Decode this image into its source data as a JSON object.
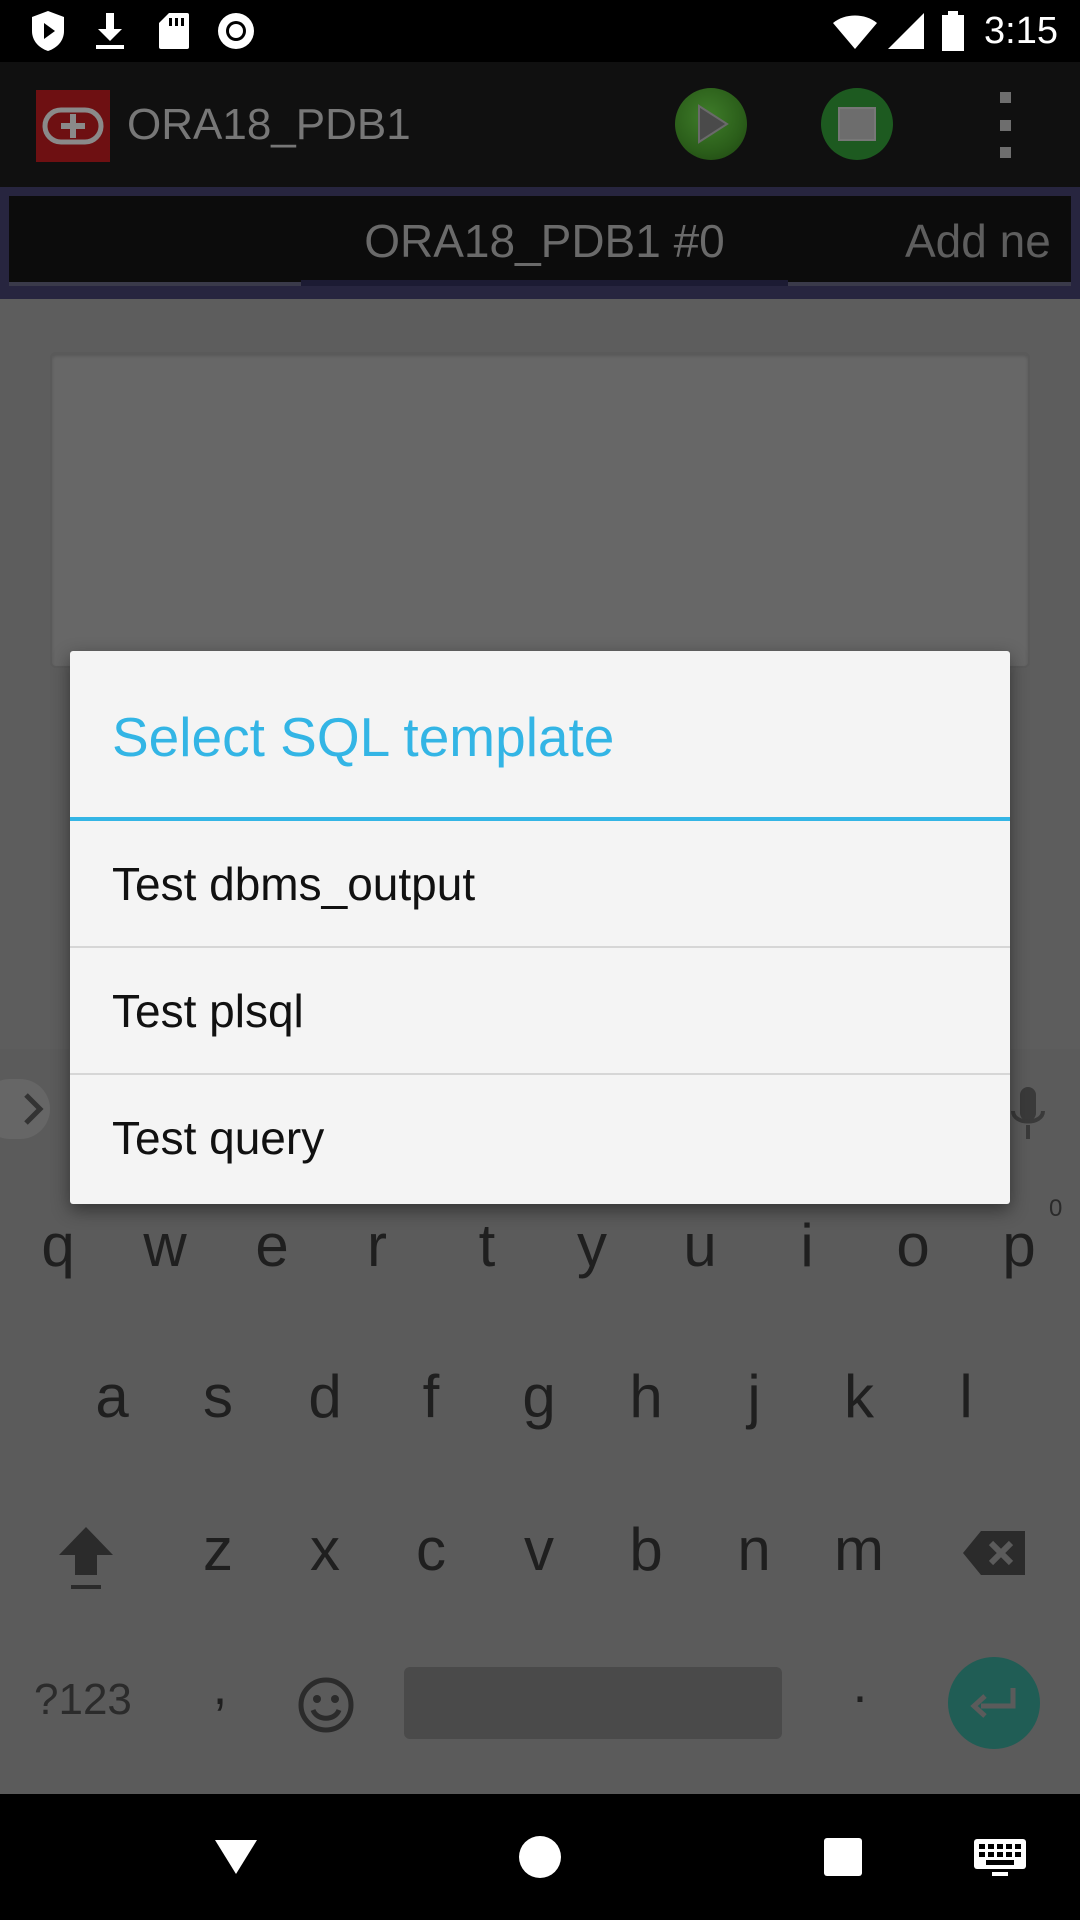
{
  "status_bar": {
    "time": "3:15",
    "icons": [
      "shield-play-icon",
      "download-icon",
      "sd-card-icon",
      "record-icon",
      "wifi-icon",
      "cell-signal-icon",
      "battery-icon"
    ]
  },
  "app_bar": {
    "title": "ORA18_PDB1",
    "logo_icon": "db-connection-logo-icon",
    "run_icon": "run-play-icon",
    "template_icon": "sql-template-icon",
    "overflow_icon": "overflow-menu-icon"
  },
  "tabs": {
    "active": "ORA18_PDB1 #0",
    "add": "Add ne"
  },
  "editor": {
    "value": ""
  },
  "dialog": {
    "title": "Select SQL template",
    "items": [
      {
        "label": "Test dbms_output"
      },
      {
        "label": "Test plsql"
      },
      {
        "label": "Test query"
      }
    ]
  },
  "keyboard": {
    "row1": [
      "q",
      "w",
      "e",
      "r",
      "t",
      "y",
      "u",
      "i",
      "o",
      "p"
    ],
    "row1_hint_last": "0",
    "row2": [
      "a",
      "s",
      "d",
      "f",
      "g",
      "h",
      "j",
      "k",
      "l"
    ],
    "row3": [
      "z",
      "x",
      "c",
      "v",
      "b",
      "n",
      "m"
    ],
    "symbols_label": "?123",
    "comma": ",",
    "period": "."
  },
  "colors": {
    "accent": "#33b5e5",
    "enter_key": "#205d55",
    "tab_strip": "#27253f"
  }
}
